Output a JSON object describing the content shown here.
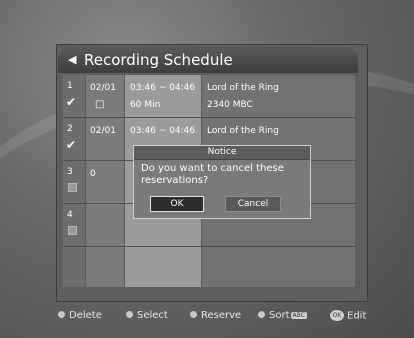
{
  "header": {
    "title": "Recording Schedule",
    "back_icon": "left-arrow-icon"
  },
  "rows": [
    {
      "num": "1",
      "date": "02/01",
      "time": "03:46 ~ 04:46",
      "duration": "60 Min",
      "title": "Lord of the Ring",
      "channel": "2340 MBC",
      "checked": true
    },
    {
      "num": "2",
      "date": "02/01",
      "time": "03:46 ~ 04:46",
      "title": "Lord of the Ring",
      "checked": true
    },
    {
      "num": "3",
      "date": "0",
      "checked": false
    },
    {
      "num": "4",
      "date": "",
      "checked": false
    }
  ],
  "dialog": {
    "title": "Notice",
    "message": "Do you want to cancel these reservations?",
    "ok_label": "OK",
    "cancel_label": "Cancel"
  },
  "footer": {
    "delete_label": "Delete",
    "select_label": "Select",
    "reserve_label": "Reserve",
    "sort_label": "Sort",
    "sort_badge": "ABC",
    "ok_badge": "OK",
    "edit_label": "Edit"
  }
}
